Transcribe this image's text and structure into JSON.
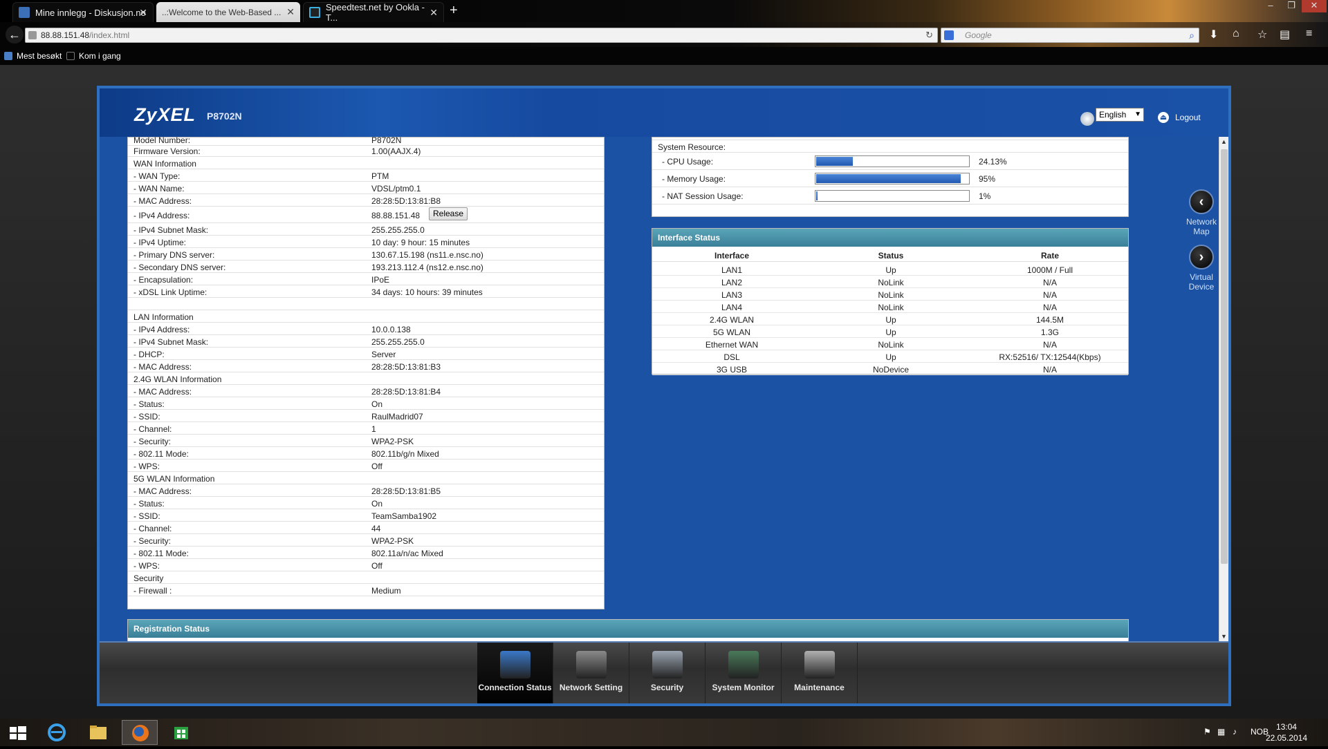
{
  "browser": {
    "tabs": [
      {
        "label": "Mine innlegg - Diskusjon.no",
        "active": false
      },
      {
        "label": "..:Welcome to the Web-Based ...",
        "active": true
      },
      {
        "label": "Speedtest.net by Ookla - T...",
        "active": false
      }
    ],
    "url_host": "88.88.151.48",
    "url_path": "/index.html",
    "search_placeholder": "Google",
    "bookmarks": [
      "Mest besøkt",
      "Kom i gang"
    ]
  },
  "router": {
    "brand": "ZyXEL",
    "model": "P8702N",
    "language": "English",
    "logout_label": "Logout",
    "release_label": "Release",
    "info_rows": [
      {
        "key": "Model Number:",
        "value": "P8702N"
      },
      {
        "key": "Firmware Version:",
        "value": "1.00(AAJX.4)"
      },
      {
        "key": "WAN Information",
        "value": ""
      },
      {
        "key": " - WAN Type:",
        "value": "PTM"
      },
      {
        "key": " - WAN Name:",
        "value": "VDSL/ptm0.1"
      },
      {
        "key": " - MAC Address:",
        "value": "28:28:5D:13:81:B8"
      },
      {
        "key": " - IPv4 Address:",
        "value": "88.88.151.48"
      },
      {
        "key": " - IPv4 Subnet Mask:",
        "value": "255.255.255.0"
      },
      {
        "key": " - IPv4 Uptime:",
        "value": "10 day: 9 hour: 15 minutes"
      },
      {
        "key": " - Primary DNS server:",
        "value": "130.67.15.198 (ns11.e.nsc.no)"
      },
      {
        "key": " - Secondary DNS server:",
        "value": "193.213.112.4 (ns12.e.nsc.no)"
      },
      {
        "key": " - Encapsulation:",
        "value": "IPoE"
      },
      {
        "key": " - xDSL Link Uptime:",
        "value": "34 days: 10 hours: 39 minutes"
      },
      {
        "key": "",
        "value": ""
      },
      {
        "key": "LAN Information",
        "value": ""
      },
      {
        "key": " - IPv4 Address:",
        "value": "10.0.0.138"
      },
      {
        "key": " - IPv4 Subnet Mask:",
        "value": "255.255.255.0"
      },
      {
        "key": " - DHCP:",
        "value": "Server"
      },
      {
        "key": " - MAC Address:",
        "value": "28:28:5D:13:81:B3"
      },
      {
        "key": "2.4G WLAN Information",
        "value": ""
      },
      {
        "key": " - MAC Address:",
        "value": "28:28:5D:13:81:B4"
      },
      {
        "key": " - Status:",
        "value": "On"
      },
      {
        "key": " - SSID:",
        "value": "RaulMadrid07"
      },
      {
        "key": " - Channel:",
        "value": "1"
      },
      {
        "key": " - Security:",
        "value": "WPA2-PSK"
      },
      {
        "key": " - 802.11 Mode:",
        "value": "802.11b/g/n Mixed"
      },
      {
        "key": " - WPS:",
        "value": "Off"
      },
      {
        "key": "5G WLAN Information",
        "value": ""
      },
      {
        "key": " - MAC Address:",
        "value": "28:28:5D:13:81:B5"
      },
      {
        "key": " - Status:",
        "value": "On"
      },
      {
        "key": " - SSID:",
        "value": "TeamSamba1902"
      },
      {
        "key": " - Channel:",
        "value": "44"
      },
      {
        "key": " - Security:",
        "value": "WPA2-PSK"
      },
      {
        "key": " - 802.11 Mode:",
        "value": "802.11a/n/ac Mixed"
      },
      {
        "key": " - WPS:",
        "value": "Off"
      },
      {
        "key": "Security",
        "value": ""
      },
      {
        "key": " - Firewall :",
        "value": "Medium"
      }
    ],
    "system": {
      "title": "System Resource:",
      "rows": [
        {
          "key": " - CPU Usage:",
          "pct_label": "24.13%",
          "level": 0.2413
        },
        {
          "key": " - Memory Usage:",
          "pct_label": "95%",
          "level": 0.95
        },
        {
          "key": " - NAT Session Usage:",
          "pct_label": "1%",
          "level": 0.01
        }
      ]
    },
    "interface_status": {
      "title": "Interface Status",
      "headers": [
        "Interface",
        "Status",
        "Rate"
      ],
      "rows": [
        [
          "LAN1",
          "Up",
          "1000M / Full"
        ],
        [
          "LAN2",
          "NoLink",
          "N/A"
        ],
        [
          "LAN3",
          "NoLink",
          "N/A"
        ],
        [
          "LAN4",
          "NoLink",
          "N/A"
        ],
        [
          "2.4G WLAN",
          "Up",
          "144.5M"
        ],
        [
          "5G WLAN",
          "Up",
          "1.3G"
        ],
        [
          "Ethernet WAN",
          "NoLink",
          "N/A"
        ],
        [
          "DSL",
          "Up",
          "RX:52516/ TX:12544(Kbps)"
        ],
        [
          "3G USB",
          "NoDevice",
          "N/A"
        ]
      ]
    },
    "registration_title": "Registration Status",
    "side_nav": [
      {
        "label": "Network Map",
        "icon": "chevron-left-icon"
      },
      {
        "label": "Virtual Device",
        "icon": "chevron-right-icon"
      }
    ],
    "bottom_nav": [
      {
        "label": "Connection Status",
        "icon": "monitor-globe-icon",
        "active": true
      },
      {
        "label": "Network Setting",
        "icon": "gear-icon",
        "active": false
      },
      {
        "label": "Security",
        "icon": "shield-icon",
        "active": false
      },
      {
        "label": "System Monitor",
        "icon": "chart-monitor-icon",
        "active": false
      },
      {
        "label": "Maintenance",
        "icon": "tools-icon",
        "active": false
      }
    ]
  },
  "taskbar": {
    "lang": "NOB",
    "time": "13:04",
    "date": "22.05.2014"
  }
}
